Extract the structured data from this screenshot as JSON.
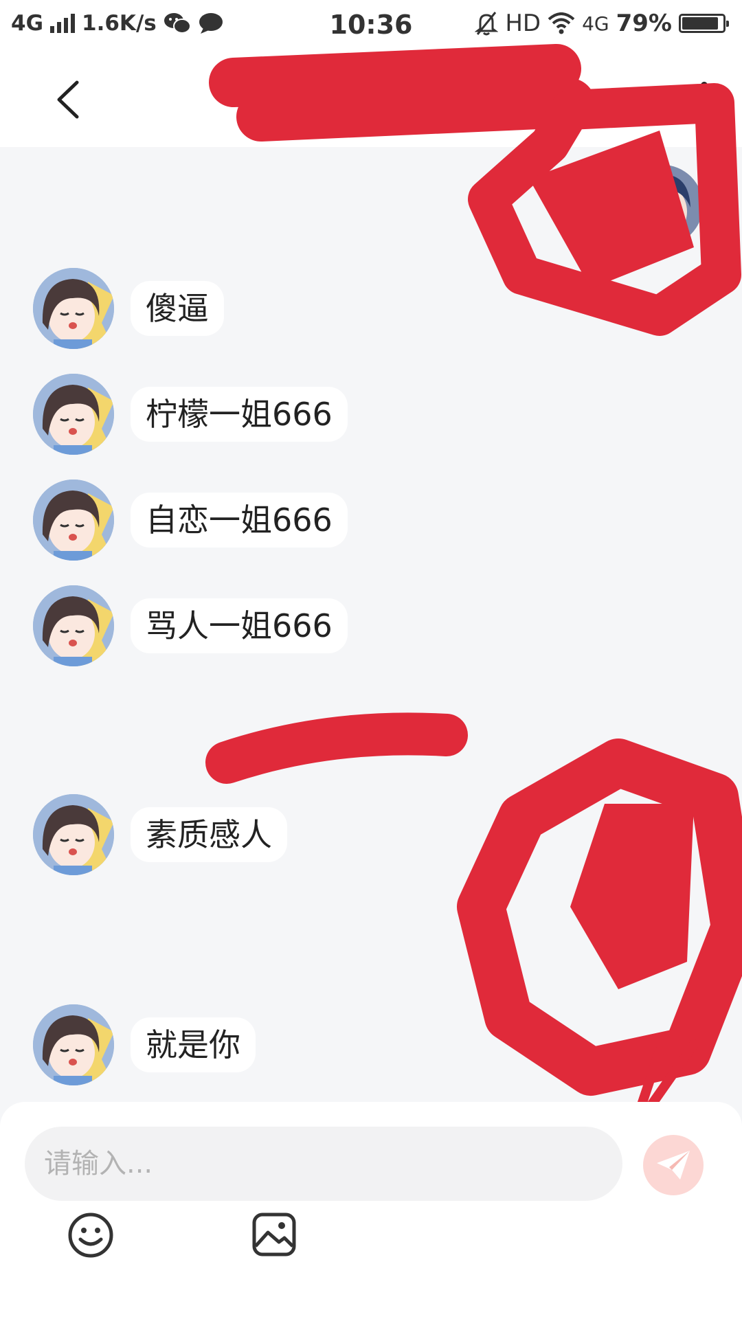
{
  "status_bar": {
    "network_left": "4G",
    "speed": "1.6K/s",
    "time": "10:36",
    "hd": "HD",
    "network_right": "4G",
    "battery": "79%"
  },
  "nav": {
    "back_icon": "chevron-left-icon",
    "more_icon": "more-vertical-icon"
  },
  "messages": [
    {
      "text": "傻逼"
    },
    {
      "text": "柠檬一姐666"
    },
    {
      "text": "自恋一姐666"
    },
    {
      "text": "骂人一姐666"
    },
    {
      "text": "素质感人"
    },
    {
      "text": "就是你"
    }
  ],
  "input": {
    "placeholder": "请输入..."
  },
  "toolbar": {
    "emoji_icon": "emoji-icon",
    "image_icon": "image-icon",
    "send_icon": "send-icon"
  },
  "colors": {
    "redaction": "#e02a3a",
    "background": "#f5f6f8",
    "send_button": "#fcd7d4"
  }
}
